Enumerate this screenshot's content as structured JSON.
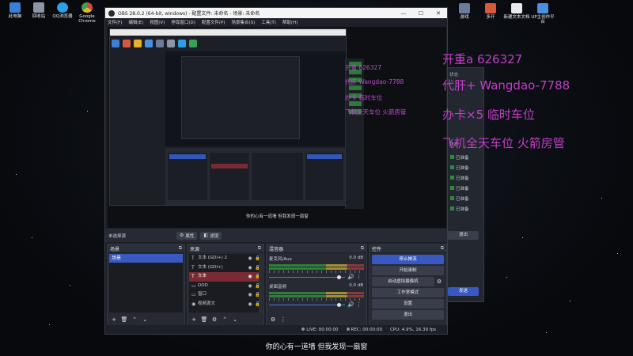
{
  "desktop_icons_left": [
    {
      "label": "此电脑",
      "icon": "computer-icon",
      "color": "#3b7fd6"
    },
    {
      "label": "回收站",
      "icon": "recycle-bin-icon",
      "color": "#8b97a8"
    },
    {
      "label": "QQ浏览器",
      "icon": "browser-icon",
      "color": "#2aa0e8"
    },
    {
      "label": "Google Chrome",
      "icon": "chrome-icon",
      "color": "#e6b32a"
    }
  ],
  "desktop_icons_right": [
    {
      "label": "游戏",
      "icon": "game-icon",
      "color": "#6c7c9b"
    },
    {
      "label": "多开",
      "icon": "multi-icon",
      "color": "#d65a3a"
    },
    {
      "label": "新建文本文档",
      "icon": "text-doc-icon",
      "color": "#e8eaee"
    },
    {
      "label": "UP主创作平台",
      "icon": "up-platform-icon",
      "color": "#4a8fe0"
    }
  ],
  "window": {
    "title": "OBS 28.0.2 (64-bit, windows) - 配置文件: 未命名 - 场景: 未命名",
    "minimize": "—",
    "maximize": "☐",
    "close": "✕",
    "menu": [
      "文件(F)",
      "编辑(E)",
      "视图(V)",
      "停靠窗口(D)",
      "配置文件(P)",
      "场景集合(S)",
      "工具(T)",
      "帮助(H)"
    ]
  },
  "preview": {
    "caption": "你的心有一道墙 但我发现一扇窗",
    "ghost_lines": [
      "开重 626327",
      "代肝 Wangdao-7788",
      "办卡 临时车位",
      "飞机全天车位 火箭房管"
    ]
  },
  "source_toolbar": {
    "no_source": "未选择源",
    "properties": "属性",
    "filters": "滤镜"
  },
  "scenes": {
    "title": "场景",
    "items": [
      {
        "label": "场景",
        "active": true
      }
    ]
  },
  "sources": {
    "title": "来源",
    "items": [
      {
        "label": "文本 (GDI+) 2",
        "active": false,
        "icon": "text-icon"
      },
      {
        "label": "文本 (GDI+)",
        "active": false,
        "icon": "text-icon"
      },
      {
        "label": "文本",
        "active": true,
        "icon": "text-icon"
      },
      {
        "label": "DOD",
        "active": false,
        "icon": "window-capture-icon"
      },
      {
        "label": "窗口",
        "active": false,
        "icon": "window-capture-icon"
      },
      {
        "label": "视频源文",
        "active": false,
        "icon": "video-capture-icon"
      }
    ]
  },
  "mixer": {
    "title": "混音器",
    "channels": [
      {
        "name": "麦克风/Aux",
        "db": "0.0 dB"
      },
      {
        "name": "桌面音频",
        "db": "0.0 dB"
      }
    ]
  },
  "controls": {
    "title": "控件",
    "buttons": [
      {
        "label": "停止推流",
        "primary": true
      },
      {
        "label": "开始录制",
        "primary": false
      },
      {
        "label": "启动虚拟摄像机",
        "primary": false,
        "gear": true
      },
      {
        "label": "工作室模式",
        "primary": false
      },
      {
        "label": "设置",
        "primary": false
      },
      {
        "label": "退出",
        "primary": false
      }
    ]
  },
  "status": {
    "live": "LIVE: 00:00:00",
    "rec": "REC: 00:00:00",
    "cpu": "CPU: 4.9%, 16.39 fps"
  },
  "right_panel": {
    "label_top": "状态",
    "label_mid": "状态",
    "items": [
      "已准备",
      "已准备",
      "已准备",
      "已准备",
      "已准备",
      "已准备"
    ],
    "exit": "退出",
    "send": "发送"
  },
  "overlay": [
    {
      "text": "开重a 626327"
    },
    {
      "text": "代肝+ Wangdao-7788"
    },
    {
      "text": "办卡×5 临时车位"
    },
    {
      "text": "飞机全天车位 火箭房管"
    }
  ],
  "subtitle": "你的心有一道墙 但我发现一扇窗"
}
